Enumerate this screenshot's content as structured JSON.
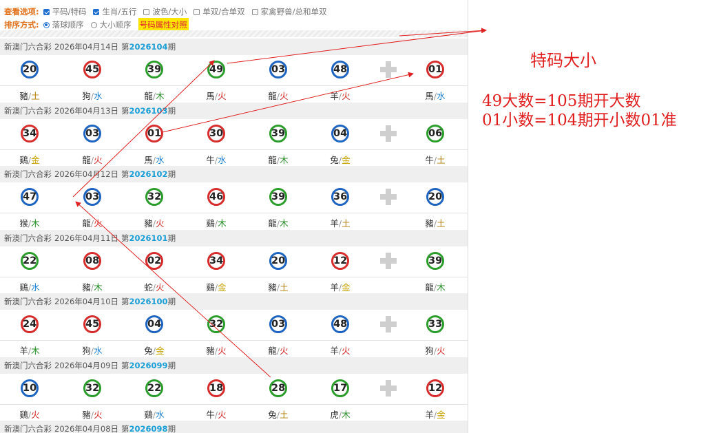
{
  "options": {
    "view_label": "查看选项:",
    "view_items": [
      {
        "label": "平码/特码",
        "checked": true
      },
      {
        "label": "生肖/五行",
        "checked": true
      },
      {
        "label": "波色/大小",
        "checked": false
      },
      {
        "label": "单双/合单双",
        "checked": false
      },
      {
        "label": "家禽野兽/总和单双",
        "checked": false
      }
    ],
    "sort_label": "排序方式:",
    "sort_items": [
      {
        "label": "落球顺序",
        "checked": true
      },
      {
        "label": "大小顺序",
        "checked": false
      }
    ],
    "attr_button": "号码属性对照"
  },
  "draw_prefix": "新澳门六合彩",
  "draw_issue_prefix": "第",
  "draw_issue_suffix": "期",
  "draws": [
    {
      "date": "2026年04月14日",
      "period": "2026104",
      "balls": [
        {
          "num": "20",
          "color": "blue",
          "zodiac": "豬",
          "element": "土"
        },
        {
          "num": "45",
          "color": "red",
          "zodiac": "狗",
          "element": "水"
        },
        {
          "num": "39",
          "color": "green",
          "zodiac": "龍",
          "element": "木"
        },
        {
          "num": "49",
          "color": "green",
          "zodiac": "馬",
          "element": "火"
        },
        {
          "num": "03",
          "color": "blue",
          "zodiac": "龍",
          "element": "火"
        },
        {
          "num": "48",
          "color": "blue",
          "zodiac": "羊",
          "element": "火"
        },
        {
          "num": "01",
          "color": "red",
          "zodiac": "馬",
          "element": "水"
        }
      ]
    },
    {
      "date": "2026年04月13日",
      "period": "2026103",
      "balls": [
        {
          "num": "34",
          "color": "red",
          "zodiac": "鷄",
          "element": "金"
        },
        {
          "num": "03",
          "color": "blue",
          "zodiac": "龍",
          "element": "火"
        },
        {
          "num": "01",
          "color": "red",
          "zodiac": "馬",
          "element": "水"
        },
        {
          "num": "30",
          "color": "red",
          "zodiac": "牛",
          "element": "水"
        },
        {
          "num": "39",
          "color": "green",
          "zodiac": "龍",
          "element": "木"
        },
        {
          "num": "04",
          "color": "blue",
          "zodiac": "兔",
          "element": "金"
        },
        {
          "num": "06",
          "color": "green",
          "zodiac": "牛",
          "element": "土"
        }
      ]
    },
    {
      "date": "2026年04月12日",
      "period": "2026102",
      "balls": [
        {
          "num": "47",
          "color": "blue",
          "zodiac": "猴",
          "element": "木"
        },
        {
          "num": "03",
          "color": "blue",
          "zodiac": "龍",
          "element": "火"
        },
        {
          "num": "32",
          "color": "green",
          "zodiac": "豬",
          "element": "火"
        },
        {
          "num": "46",
          "color": "red",
          "zodiac": "鷄",
          "element": "木"
        },
        {
          "num": "39",
          "color": "green",
          "zodiac": "龍",
          "element": "木"
        },
        {
          "num": "36",
          "color": "blue",
          "zodiac": "羊",
          "element": "土"
        },
        {
          "num": "20",
          "color": "blue",
          "zodiac": "豬",
          "element": "土"
        }
      ]
    },
    {
      "date": "2026年04月11日",
      "period": "2026101",
      "balls": [
        {
          "num": "22",
          "color": "green",
          "zodiac": "鷄",
          "element": "水"
        },
        {
          "num": "08",
          "color": "red",
          "zodiac": "豬",
          "element": "木"
        },
        {
          "num": "02",
          "color": "red",
          "zodiac": "蛇",
          "element": "火"
        },
        {
          "num": "34",
          "color": "red",
          "zodiac": "鷄",
          "element": "金"
        },
        {
          "num": "20",
          "color": "blue",
          "zodiac": "豬",
          "element": "土"
        },
        {
          "num": "12",
          "color": "red",
          "zodiac": "羊",
          "element": "金"
        },
        {
          "num": "39",
          "color": "green",
          "zodiac": "龍",
          "element": "木"
        }
      ]
    },
    {
      "date": "2026年04月10日",
      "period": "2026100",
      "balls": [
        {
          "num": "24",
          "color": "red",
          "zodiac": "羊",
          "element": "木"
        },
        {
          "num": "45",
          "color": "red",
          "zodiac": "狗",
          "element": "水"
        },
        {
          "num": "04",
          "color": "blue",
          "zodiac": "兔",
          "element": "金"
        },
        {
          "num": "32",
          "color": "green",
          "zodiac": "豬",
          "element": "火"
        },
        {
          "num": "03",
          "color": "blue",
          "zodiac": "龍",
          "element": "火"
        },
        {
          "num": "48",
          "color": "blue",
          "zodiac": "羊",
          "element": "火"
        },
        {
          "num": "33",
          "color": "green",
          "zodiac": "狗",
          "element": "火"
        }
      ]
    },
    {
      "date": "2026年04月09日",
      "period": "2026099",
      "balls": [
        {
          "num": "10",
          "color": "blue",
          "zodiac": "鷄",
          "element": "火"
        },
        {
          "num": "32",
          "color": "green",
          "zodiac": "豬",
          "element": "火"
        },
        {
          "num": "22",
          "color": "green",
          "zodiac": "鷄",
          "element": "水"
        },
        {
          "num": "18",
          "color": "red",
          "zodiac": "牛",
          "element": "火"
        },
        {
          "num": "28",
          "color": "green",
          "zodiac": "兔",
          "element": "土"
        },
        {
          "num": "17",
          "color": "green",
          "zodiac": "虎",
          "element": "木"
        },
        {
          "num": "12",
          "color": "red",
          "zodiac": "羊",
          "element": "金"
        }
      ]
    },
    {
      "date": "2026年04月08日",
      "period": "2026098",
      "balls": []
    }
  ],
  "annotation": {
    "title": "特码大小",
    "line1": "49大数=105期开大数",
    "line2": "01小数=104期开小数01准",
    "color": "#e02020"
  },
  "colors": {
    "red_ball": "#d72c2c",
    "blue_ball": "#1d64c0",
    "green_ball": "#2b9d2b",
    "period_number": "#1a9ed6",
    "option_label": "#e0701a"
  }
}
